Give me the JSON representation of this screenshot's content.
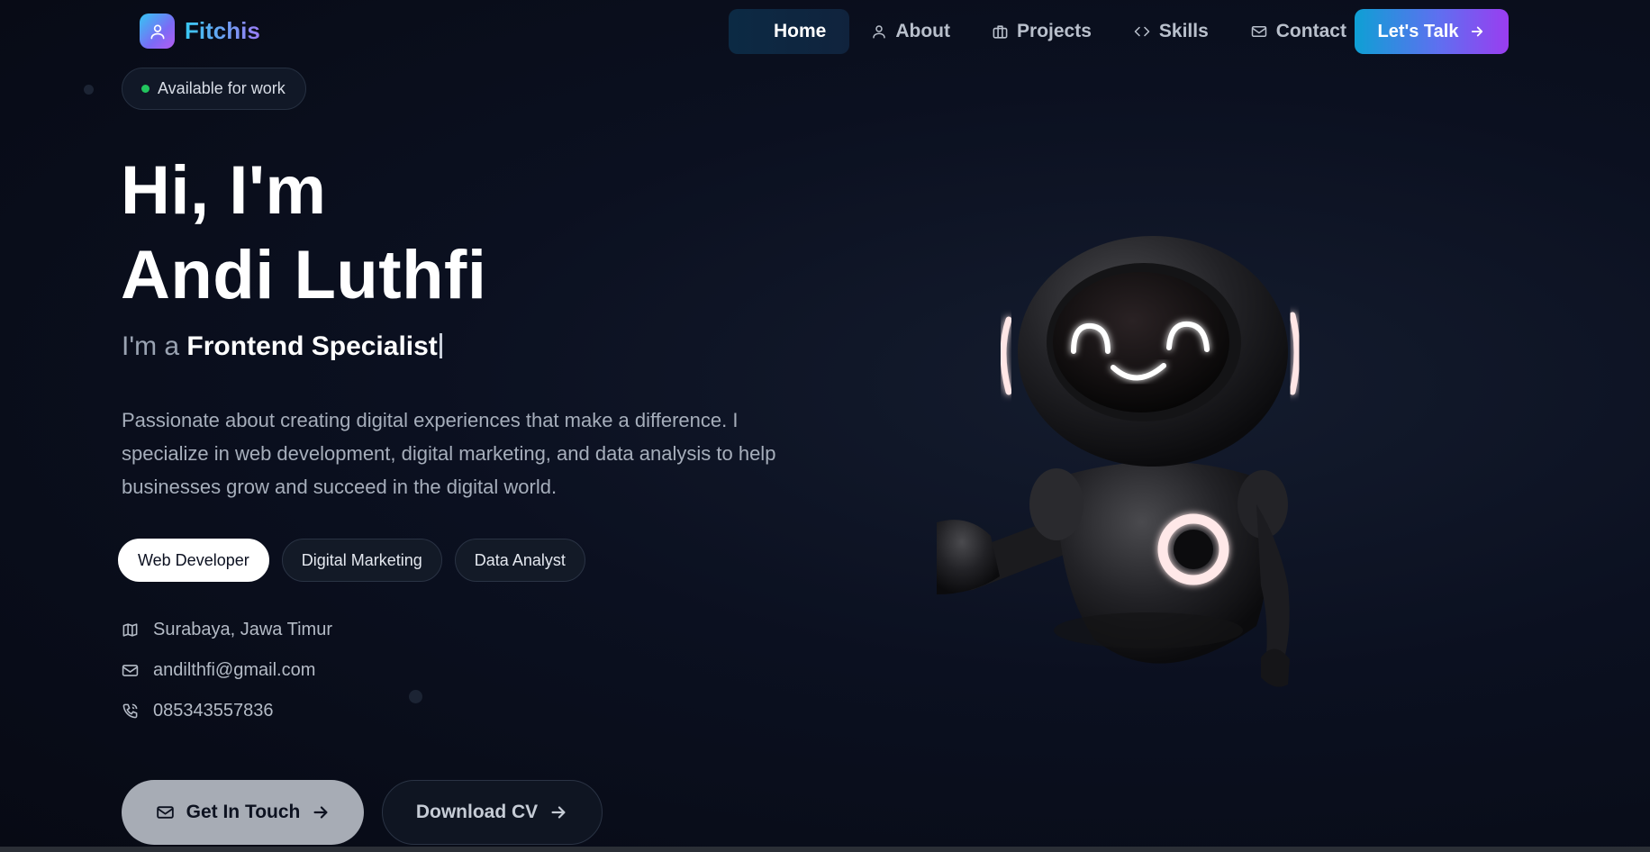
{
  "header": {
    "logo_text": "Fitchis",
    "nav": [
      {
        "label": "Home",
        "icon": "none",
        "active": true
      },
      {
        "label": "About",
        "icon": "user-icon",
        "active": false
      },
      {
        "label": "Projects",
        "icon": "briefcase-icon",
        "active": false
      },
      {
        "label": "Skills",
        "icon": "code-icon",
        "active": false
      },
      {
        "label": "Contact",
        "icon": "mail-icon",
        "active": false
      }
    ],
    "cta_label": "Let's Talk"
  },
  "hero": {
    "availability": "Available for work",
    "greeting": "Hi, I'm",
    "name": "Andi Luthfi",
    "role_prefix": "I'm a",
    "role_typed": "Frontend Specialist",
    "description": "Passionate about creating digital experiences that make a difference. I specialize in web development, digital marketing, and data analysis to help businesses grow and succeed in the digital world.",
    "chips": [
      {
        "label": "Web Developer",
        "selected": true
      },
      {
        "label": "Digital Marketing",
        "selected": false
      },
      {
        "label": "Data Analyst",
        "selected": false
      }
    ],
    "contact": {
      "location": "Surabaya, Jawa Timur",
      "email": "andilthfi@gmail.com",
      "phone": "085343557836"
    },
    "primary_button": "Get In Touch",
    "secondary_button": "Download CV"
  },
  "colors": {
    "accent_cyan": "#0ea0d4",
    "accent_purple": "#9a3df0",
    "status_green": "#22c55e",
    "background": "#0b1020"
  }
}
